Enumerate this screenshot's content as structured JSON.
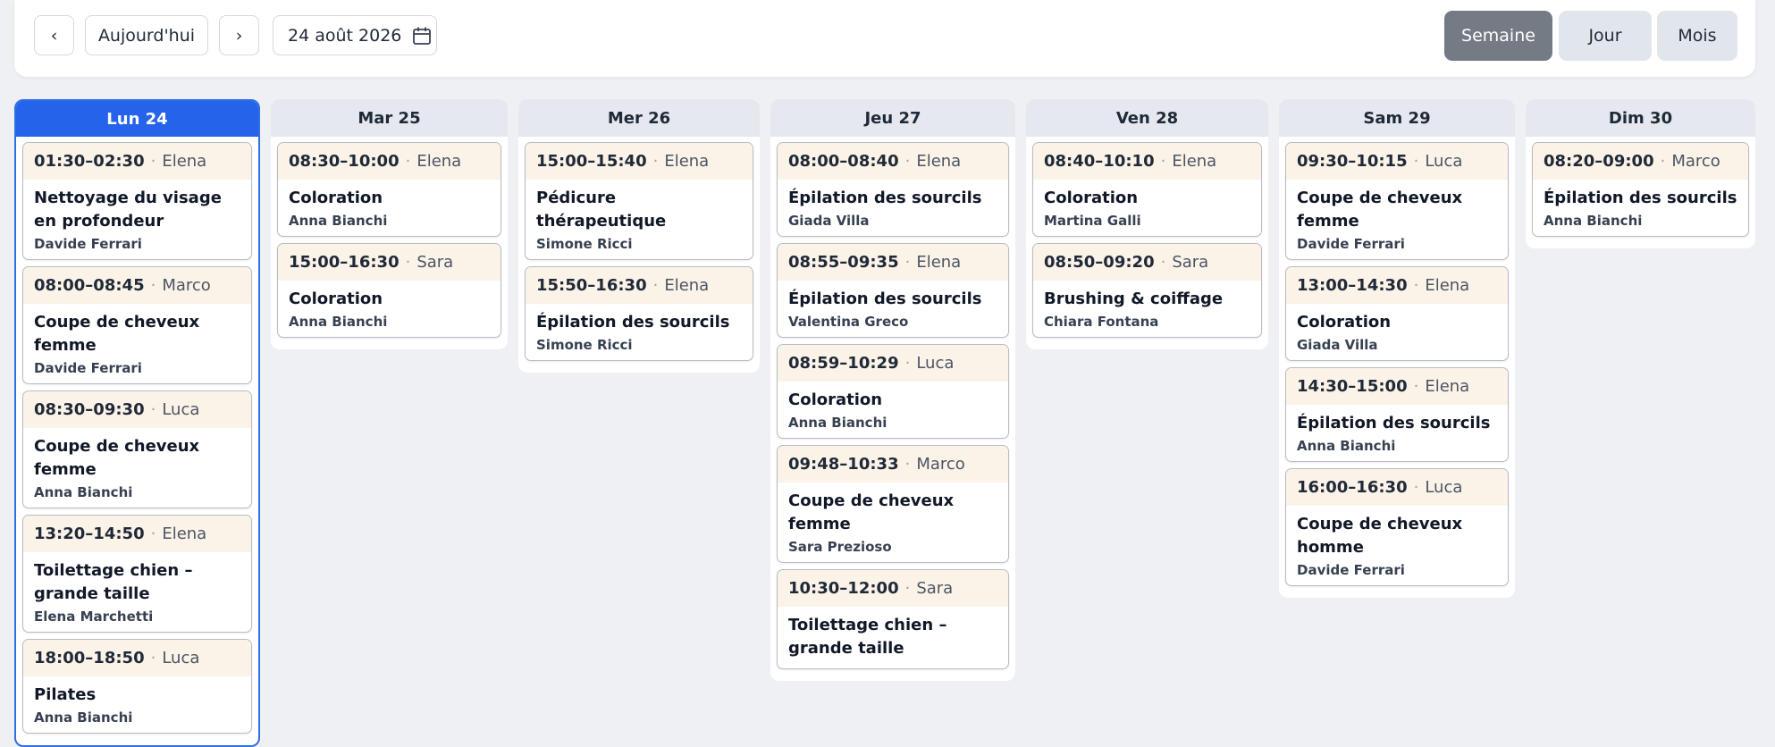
{
  "toolbar": {
    "prev_label": "‹",
    "today_label": "Aujourd'hui",
    "next_label": "›",
    "date_value": "24 août 2026",
    "views": {
      "week": "Semaine",
      "day": "Jour",
      "month": "Mois"
    },
    "active_view": "Semaine"
  },
  "colors": {
    "accent": "#2563eb",
    "event_header": "#fbf2e8",
    "active_view_bg": "#757b85"
  },
  "days": [
    {
      "label": "Lun 24",
      "today": true,
      "events": [
        {
          "time": "01:30–02:30",
          "staff": "Elena",
          "title": "Nettoyage du visage en profondeur",
          "client": "Davide Ferrari"
        },
        {
          "time": "08:00–08:45",
          "staff": "Marco",
          "title": "Coupe de cheveux femme",
          "client": "Davide Ferrari"
        },
        {
          "time": "08:30–09:30",
          "staff": "Luca",
          "title": "Coupe de cheveux femme",
          "client": "Anna Bianchi"
        },
        {
          "time": "13:20–14:50",
          "staff": "Elena",
          "title": "Toilettage chien – grande taille",
          "client": "Elena Marchetti"
        },
        {
          "time": "18:00–18:50",
          "staff": "Luca",
          "title": "Pilates",
          "client": "Anna Bianchi"
        }
      ]
    },
    {
      "label": "Mar 25",
      "today": false,
      "events": [
        {
          "time": "08:30–10:00",
          "staff": "Elena",
          "title": "Coloration",
          "client": "Anna Bianchi"
        },
        {
          "time": "15:00–16:30",
          "staff": "Sara",
          "title": "Coloration",
          "client": "Anna Bianchi"
        }
      ]
    },
    {
      "label": "Mer 26",
      "today": false,
      "events": [
        {
          "time": "15:00–15:40",
          "staff": "Elena",
          "title": "Pédicure thérapeutique",
          "client": "Simone Ricci"
        },
        {
          "time": "15:50–16:30",
          "staff": "Elena",
          "title": "Épilation des sourcils",
          "client": "Simone Ricci"
        }
      ]
    },
    {
      "label": "Jeu 27",
      "today": false,
      "events": [
        {
          "time": "08:00–08:40",
          "staff": "Elena",
          "title": "Épilation des sourcils",
          "client": "Giada Villa"
        },
        {
          "time": "08:55–09:35",
          "staff": "Elena",
          "title": "Épilation des sourcils",
          "client": "Valentina Greco"
        },
        {
          "time": "08:59–10:29",
          "staff": "Luca",
          "title": "Coloration",
          "client": "Anna Bianchi"
        },
        {
          "time": "09:48–10:33",
          "staff": "Marco",
          "title": "Coupe de cheveux femme",
          "client": "Sara Prezioso"
        },
        {
          "time": "10:30–12:00",
          "staff": "Sara",
          "title": "Toilettage chien – grande taille",
          "client": ""
        }
      ]
    },
    {
      "label": "Ven 28",
      "today": false,
      "events": [
        {
          "time": "08:40–10:10",
          "staff": "Elena",
          "title": "Coloration",
          "client": "Martina Galli"
        },
        {
          "time": "08:50–09:20",
          "staff": "Sara",
          "title": "Brushing & coiffage",
          "client": "Chiara Fontana"
        }
      ]
    },
    {
      "label": "Sam 29",
      "today": false,
      "events": [
        {
          "time": "09:30–10:15",
          "staff": "Luca",
          "title": "Coupe de cheveux femme",
          "client": "Davide Ferrari"
        },
        {
          "time": "13:00–14:30",
          "staff": "Elena",
          "title": "Coloration",
          "client": "Giada Villa"
        },
        {
          "time": "14:30–15:00",
          "staff": "Elena",
          "title": "Épilation des sourcils",
          "client": "Anna Bianchi"
        },
        {
          "time": "16:00–16:30",
          "staff": "Luca",
          "title": "Coupe de cheveux homme",
          "client": "Davide Ferrari"
        }
      ]
    },
    {
      "label": "Dim 30",
      "today": false,
      "events": [
        {
          "time": "08:20–09:00",
          "staff": "Marco",
          "title": "Épilation des sourcils",
          "client": "Anna Bianchi"
        }
      ]
    }
  ]
}
